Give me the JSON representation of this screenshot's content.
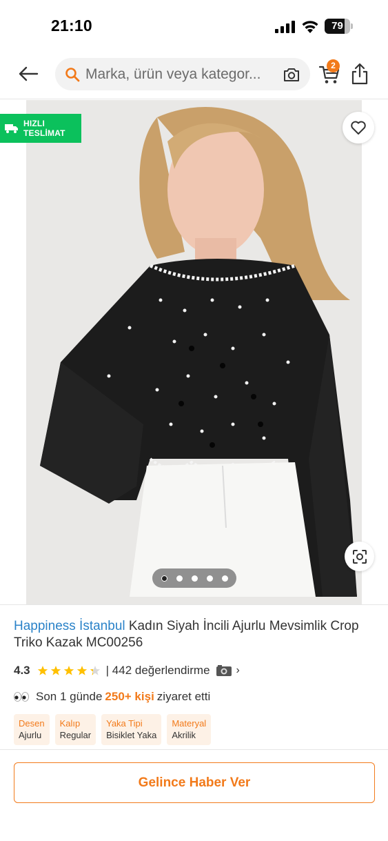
{
  "status_bar": {
    "time": "21:10",
    "battery_percent": 79,
    "battery_label": "79"
  },
  "nav": {
    "search_placeholder": "Marka, ürün veya kategor...",
    "cart_count": "2"
  },
  "product_image": {
    "fast_delivery_line1": "HIZLI",
    "fast_delivery_line2": "TESLİMAT",
    "carousel_dot_count": 5,
    "carousel_active_index": 0
  },
  "product": {
    "brand": "Happiness İstanbul",
    "title": " Kadın Siyah İncili Ajurlu Mevsimlik Crop Triko Kazak MC00256",
    "rating": "4.3",
    "rating_value": 4.3,
    "review_count": "| 442 değerlendirme",
    "visit_prefix": "Son 1 günde",
    "visit_highlight": "250+ kişi",
    "visit_suffix": "ziyaret etti",
    "attributes": [
      {
        "name": "Desen",
        "value": "Ajurlu"
      },
      {
        "name": "Kalıp",
        "value": "Regular"
      },
      {
        "name": "Yaka Tipi",
        "value": "Bisiklet Yaka"
      },
      {
        "name": "Materyal",
        "value": "Akrilik"
      }
    ]
  },
  "actions": {
    "notify_label": "Gelince Haber Ver"
  },
  "colors": {
    "accent": "#f27a1a",
    "brand_link": "#2a82c8",
    "fast_badge": "#0bc15c",
    "star": "#ffc000"
  },
  "icons": [
    "signal-icon",
    "wifi-icon",
    "battery-icon",
    "back-arrow-icon",
    "search-icon",
    "camera-search-icon",
    "cart-icon",
    "share-icon",
    "delivery-truck-icon",
    "heart-icon",
    "visual-search-icon",
    "star-icon",
    "camera-icon",
    "chevron-right-icon",
    "eyes-icon"
  ]
}
